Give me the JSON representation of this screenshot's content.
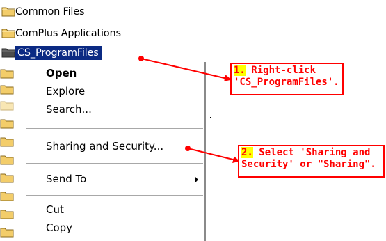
{
  "tree": {
    "rows": [
      {
        "label": "Common Files",
        "selected": false
      },
      {
        "label": "ComPlus Applications",
        "selected": false
      },
      {
        "label": "CS_ProgramFiles",
        "selected": true
      }
    ]
  },
  "context_menu": {
    "items": [
      {
        "label": "Open",
        "bold": true
      },
      {
        "label": "Explore"
      },
      {
        "label": "Search..."
      },
      {
        "label": "Sharing and Security..."
      },
      {
        "label": "Send To",
        "submenu": true
      },
      {
        "label": "Cut"
      },
      {
        "label": "Copy"
      }
    ]
  },
  "callouts": [
    {
      "number": "1.",
      "line1": "Right-click",
      "line2": "'CS_ProgramFiles'."
    },
    {
      "number": "2.",
      "line1": "Select 'Sharing and",
      "line2": "Security' or \"Sharing\"."
    }
  ],
  "colors": {
    "selection": "#0b2a83",
    "callout_red": "#ff0000",
    "number_highlight": "#ffff00",
    "folder_yellow": "#f5d27a"
  }
}
